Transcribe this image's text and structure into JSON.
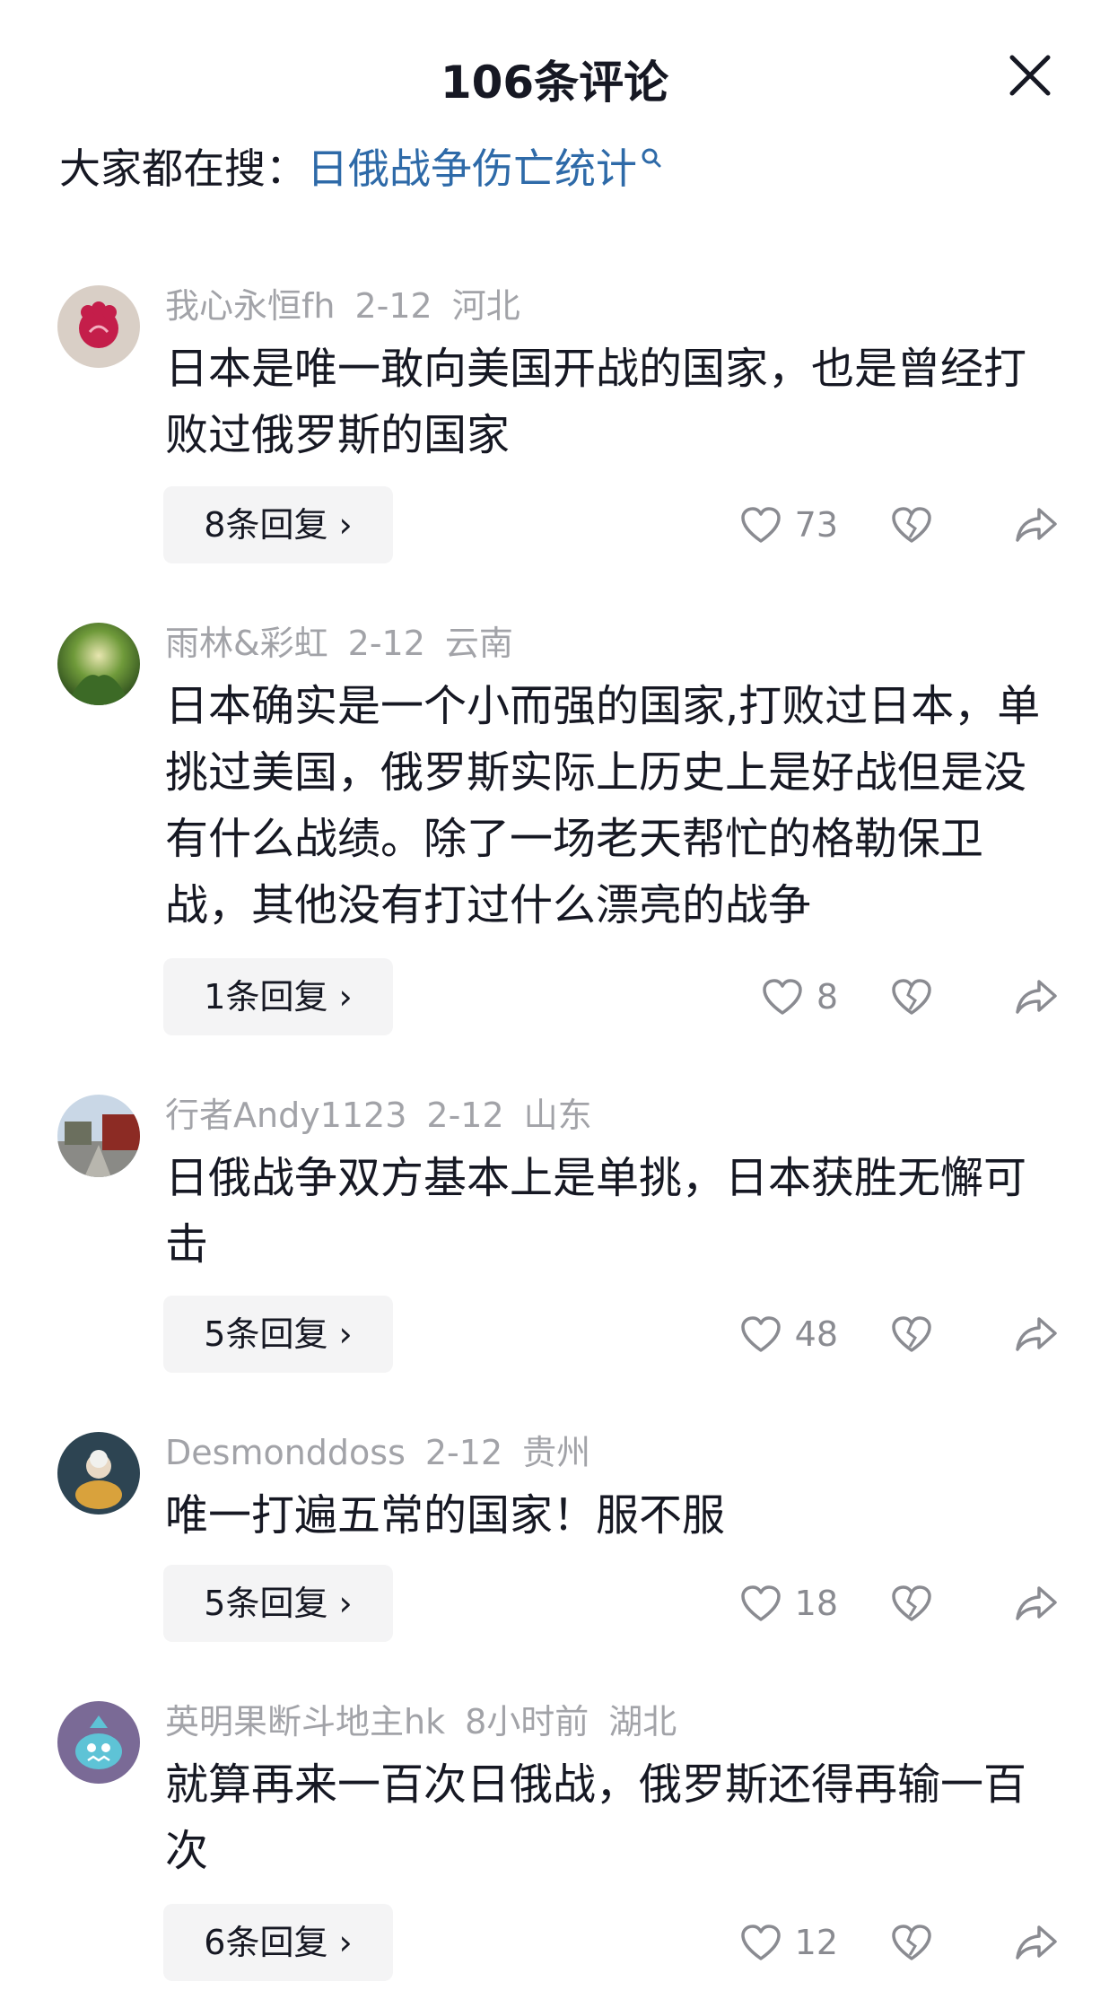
{
  "header": {
    "title": "106条评论"
  },
  "search": {
    "prefix": "大家都在搜：",
    "term": "日俄战争伤亡统计"
  },
  "comments": [
    {
      "user": "我心永恒fh",
      "date": "2-12",
      "location": "河北",
      "text": "日本是唯一敢向美国开战的国家，也是曾经打败过俄罗斯的国家",
      "replies": "8条回复 ›",
      "likes": "73"
    },
    {
      "user": "雨林&彩虹",
      "date": "2-12",
      "location": "云南",
      "text": "日本确实是一个小而强的国家,打败过日本，单挑过美国，俄罗斯实际上历史上是好战但是没有什么战绩。除了一场老天帮忙的格勒保卫战，其他没有打过什么漂亮的战争",
      "replies": "1条回复 ›",
      "likes": "8"
    },
    {
      "user": "行者Andy1123",
      "date": "2-12",
      "location": "山东",
      "text": "日俄战争双方基本上是单挑，日本获胜无懈可击",
      "replies": "5条回复 ›",
      "likes": "48"
    },
    {
      "user": "Desmonddoss",
      "date": "2-12",
      "location": "贵州",
      "text": "唯一打遍五常的国家！服不服",
      "replies": "5条回复 ›",
      "likes": "18"
    },
    {
      "user": "英明果断斗地主hk",
      "date": "8小时前",
      "location": "湖北",
      "text": "就算再来一百次日俄战，俄罗斯还得再输一百次",
      "replies": "6条回复 ›",
      "likes": "12"
    }
  ],
  "icons": {
    "close": "close-icon",
    "search": "search-icon",
    "like": "heart-icon",
    "dislike": "broken-heart-icon",
    "share": "share-arrow-icon"
  },
  "colors": {
    "accent_link": "#2e6aa8",
    "meta_gray": "#a2a3a8",
    "reply_bg": "#f4f4f5"
  }
}
